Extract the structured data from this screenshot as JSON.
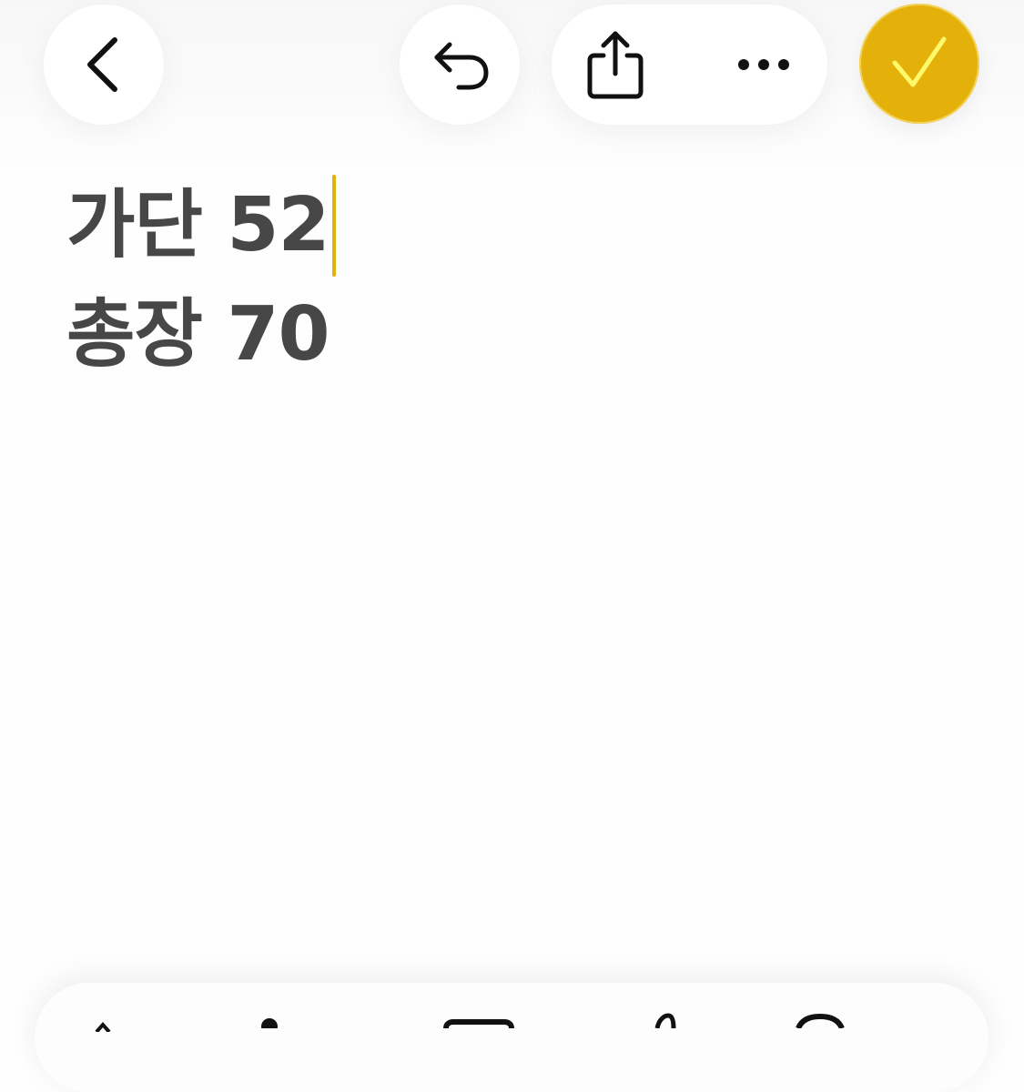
{
  "app": {
    "accent_color": "#e3b10a",
    "text_color": "#474747"
  },
  "nav": {
    "back_icon": "chevron-left-icon",
    "undo_icon": "undo-arrow-icon",
    "share_icon": "share-icon",
    "more_icon": "ellipsis-icon",
    "done_icon": "checkmark-icon"
  },
  "note": {
    "lines": [
      "가단 52",
      "총장 70"
    ]
  },
  "toolbar": {
    "icons": [
      "checklist-icon",
      "camera-icon",
      "table-icon",
      "pen-icon",
      "compose-icon"
    ]
  }
}
